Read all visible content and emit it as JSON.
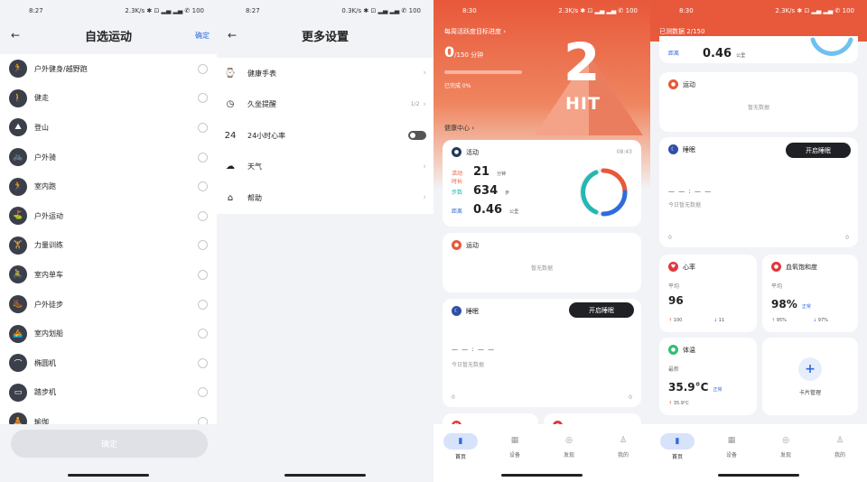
{
  "status_bars": [
    {
      "time": "8:27",
      "indicators": "2.3K/s ✱ ⊡ ▂▄ ▂▄ ✆ 100"
    },
    {
      "time": "8:27",
      "indicators": "0.3K/s ✱ ⊡ ▂▄ ▂▄ ✆ 100"
    },
    {
      "time": "8:30",
      "indicators": "2.3K/s ✱ ⊡ ▂▄ ▂▄ ✆ 100"
    },
    {
      "time": "8:30",
      "indicators": "2.3K/s ✱ ⊡ ▂▄ ▂▄ ✆ 100"
    }
  ],
  "panel1": {
    "title": "自选运动",
    "action": "确定",
    "sports": [
      {
        "name": "户外健身/越野跑",
        "icon": "runner-icon"
      },
      {
        "name": "健走",
        "icon": "walk-icon"
      },
      {
        "name": "登山",
        "icon": "hiking-icon"
      },
      {
        "name": "户外骑",
        "icon": "cycling-icon"
      },
      {
        "name": "室内跑",
        "icon": "indoor-run-icon"
      },
      {
        "name": "户外运动",
        "icon": "outdoor-icon"
      },
      {
        "name": "力量训练",
        "icon": "strength-icon"
      },
      {
        "name": "室内单车",
        "icon": "indoor-bike-icon"
      },
      {
        "name": "户外徒步",
        "icon": "trek-icon"
      },
      {
        "name": "室内划船",
        "icon": "rowing-icon"
      },
      {
        "name": "椭圆机",
        "icon": "elliptical-icon"
      },
      {
        "name": "踏步机",
        "icon": "stepper-icon"
      },
      {
        "name": "瑜伽",
        "icon": "yoga-icon"
      }
    ],
    "button": "确定"
  },
  "panel2": {
    "title": "更多设置",
    "items": [
      {
        "label": "健康手表",
        "value": "",
        "icon": "watch-icon",
        "control": "chevron"
      },
      {
        "label": "久坐提醒",
        "value": "1/2",
        "icon": "clock-icon",
        "control": "chevron"
      },
      {
        "label": "24小时心率",
        "value": "",
        "icon": "heart-24-icon",
        "control": "toggle"
      },
      {
        "label": "天气",
        "value": "",
        "icon": "weather-icon",
        "control": "chevron"
      },
      {
        "label": "帮助",
        "value": "",
        "icon": "home-icon",
        "control": "chevron"
      }
    ]
  },
  "panel3": {
    "goal_title": "每周活跃度目标进度",
    "goal_value": "0",
    "goal_unit": "/150 分钟",
    "goal_sub": "已完成 0%",
    "badge_number": "2",
    "badge_text": "HIT",
    "section_label": "健康中心 ›",
    "activity_card": {
      "title": "活动",
      "time": "08:43",
      "rows": [
        {
          "label": "活动时长",
          "value": "21",
          "unit": "分钟",
          "color": "#e8583a"
        },
        {
          "label": "步数",
          "value": "634",
          "unit": "步",
          "color": "#25b7b1"
        },
        {
          "label": "距离",
          "value": "0.46",
          "unit": "公里",
          "color": "#2f6bdb"
        }
      ]
    },
    "sport_card": {
      "title": "运动",
      "empty": "暂无数据"
    },
    "sleep_card": {
      "title": "睡眠",
      "button": "开启睡眠",
      "dashes": "— — : — —",
      "sub": "今日暂无数据",
      "axis_start": "0",
      "axis_end": "0"
    },
    "tabs": [
      {
        "label": "首页",
        "icon": "home-tab-icon",
        "active": true
      },
      {
        "label": "设备",
        "icon": "device-tab-icon",
        "active": false
      },
      {
        "label": "发现",
        "icon": "discover-tab-icon",
        "active": false
      },
      {
        "label": "我的",
        "icon": "profile-tab-icon",
        "active": false
      }
    ]
  },
  "panel4": {
    "header": "已测数据 2/150",
    "top_value": "0.46",
    "top_unit": "公里",
    "top_label": "距离",
    "sport_card": {
      "title": "运动",
      "empty": "暂无数据"
    },
    "sleep_card": {
      "title": "睡眠",
      "button": "开启睡眠",
      "dashes": "— — : — —",
      "sub": "今日暂无数据",
      "axis_start": "0",
      "axis_end": "0"
    },
    "heart_card": {
      "title": "心率",
      "sub": "平均",
      "value": "96",
      "low": "100",
      "high": "11"
    },
    "spo2_card": {
      "title": "血氧饱和度",
      "sub": "平均",
      "value": "98%",
      "status": "正常",
      "low": "95%",
      "high": "97%"
    },
    "temp_card": {
      "title": "体温",
      "sub": "最新",
      "value": "35.9°C",
      "status": "正常",
      "low": "35.9°C"
    },
    "add_card": {
      "label": "卡片管理",
      "symbol": "+"
    },
    "tabs": [
      {
        "label": "首页",
        "icon": "home-tab-icon",
        "active": true
      },
      {
        "label": "设备",
        "icon": "device-tab-icon",
        "active": false
      },
      {
        "label": "发现",
        "icon": "discover-tab-icon",
        "active": false
      },
      {
        "label": "我的",
        "icon": "profile-tab-icon",
        "active": false
      }
    ]
  },
  "colors": {
    "accent": "#e8583a",
    "blue": "#2f6bdb",
    "teal": "#25b7b1",
    "red": "#e0383e"
  }
}
